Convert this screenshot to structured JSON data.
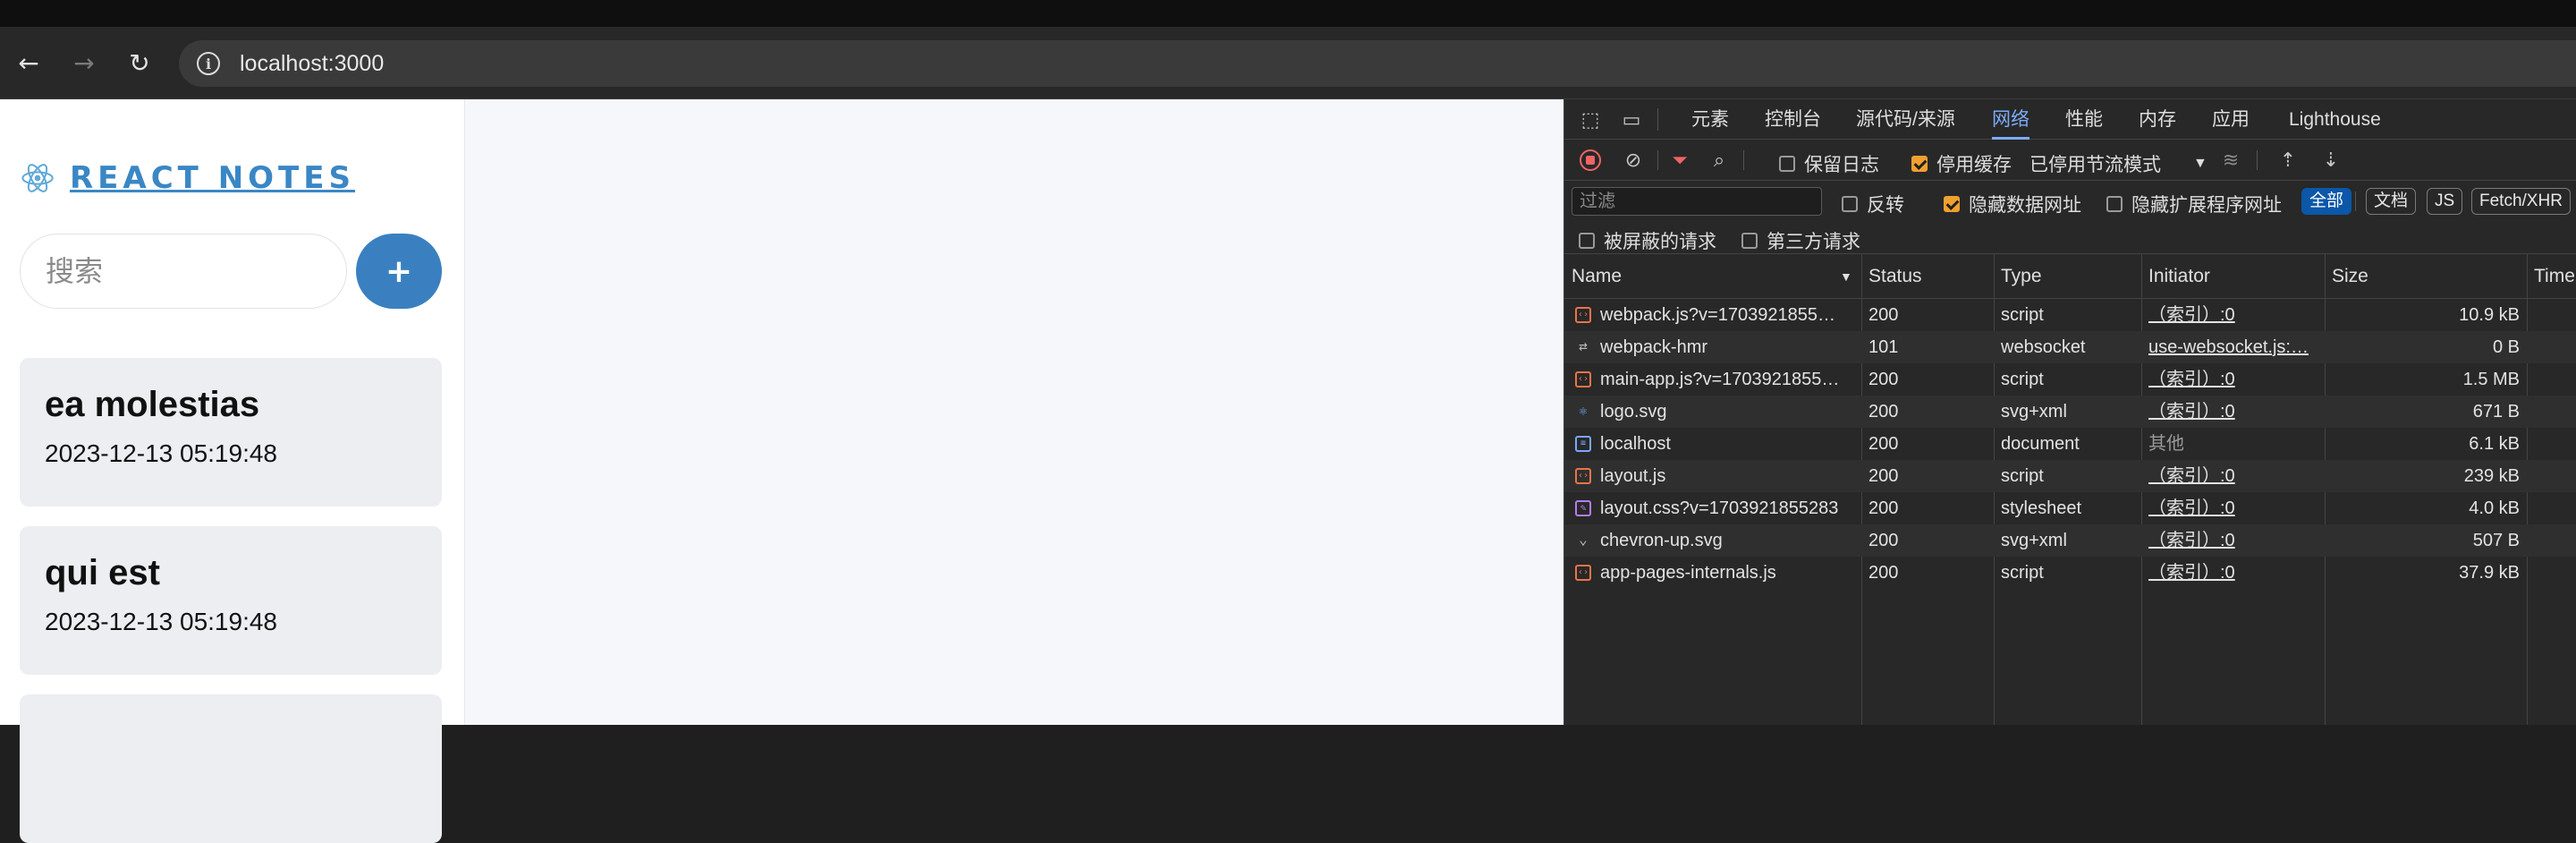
{
  "browser": {
    "url": "localhost:3000",
    "back_icon": "arrow-left-icon",
    "forward_icon": "arrow-right-icon",
    "reload_icon": "reload-icon",
    "site_info_icon": "info-icon"
  },
  "app": {
    "title": "REACT NOTES",
    "search_placeholder": "搜索",
    "add_label": "+",
    "notes": [
      {
        "title": "ea molestias",
        "date": "2023-12-13 05:19:48"
      },
      {
        "title": "qui est",
        "date": "2023-12-13 05:19:48"
      }
    ],
    "accent_color": "#3a80c0"
  },
  "devtools": {
    "tabs": [
      {
        "label": "元素"
      },
      {
        "label": "控制台"
      },
      {
        "label": "源代码/来源"
      },
      {
        "label": "网络"
      },
      {
        "label": "性能"
      },
      {
        "label": "内存"
      },
      {
        "label": "应用"
      },
      {
        "label": "Lighthouse"
      }
    ],
    "active_tab": "网络",
    "toolbar": {
      "preserve_log": "保留日志",
      "disable_cache": "停用缓存",
      "throttle": "已停用节流模式"
    },
    "filter": {
      "placeholder": "过滤",
      "invert": "反转",
      "hide_data_urls": "隐藏数据网址",
      "hide_ext_urls": "隐藏扩展程序网址",
      "chips": [
        "全部",
        "文档",
        "JS",
        "Fetch/XHR"
      ]
    },
    "options": {
      "blocked": "被屏蔽的请求",
      "third_party": "第三方请求"
    },
    "columns": {
      "name": "Name",
      "status": "Status",
      "type": "Type",
      "initiator": "Initiator",
      "size": "Size",
      "time": "Time"
    },
    "requests": [
      {
        "name": "webpack.js?v=1703921855…",
        "status": "200",
        "type": "script",
        "initiator": "（索引）:0",
        "size": "10.9 kB",
        "icon": "script"
      },
      {
        "name": "webpack-hmr",
        "status": "101",
        "type": "websocket",
        "initiator": "use-websocket.js:…",
        "size": "0 B",
        "icon": "ws"
      },
      {
        "name": "main-app.js?v=1703921855…",
        "status": "200",
        "type": "script",
        "initiator": "（索引）:0",
        "size": "1.5 MB",
        "icon": "script"
      },
      {
        "name": "logo.svg",
        "status": "200",
        "type": "svg+xml",
        "initiator": "（索引）:0",
        "size": "671 B",
        "icon": "svg"
      },
      {
        "name": "localhost",
        "status": "200",
        "type": "document",
        "initiator": "其他",
        "size": "6.1 kB",
        "icon": "doc"
      },
      {
        "name": "layout.js",
        "status": "200",
        "type": "script",
        "initiator": "（索引）:0",
        "size": "239 kB",
        "icon": "script"
      },
      {
        "name": "layout.css?v=1703921855283",
        "status": "200",
        "type": "stylesheet",
        "initiator": "（索引）:0",
        "size": "4.0 kB",
        "icon": "css"
      },
      {
        "name": "chevron-up.svg",
        "status": "200",
        "type": "svg+xml",
        "initiator": "（索引）:0",
        "size": "507 B",
        "icon": "chev"
      },
      {
        "name": "app-pages-internals.js",
        "status": "200",
        "type": "script",
        "initiator": "（索引）:0",
        "size": "37.9 kB",
        "icon": "script"
      }
    ]
  }
}
